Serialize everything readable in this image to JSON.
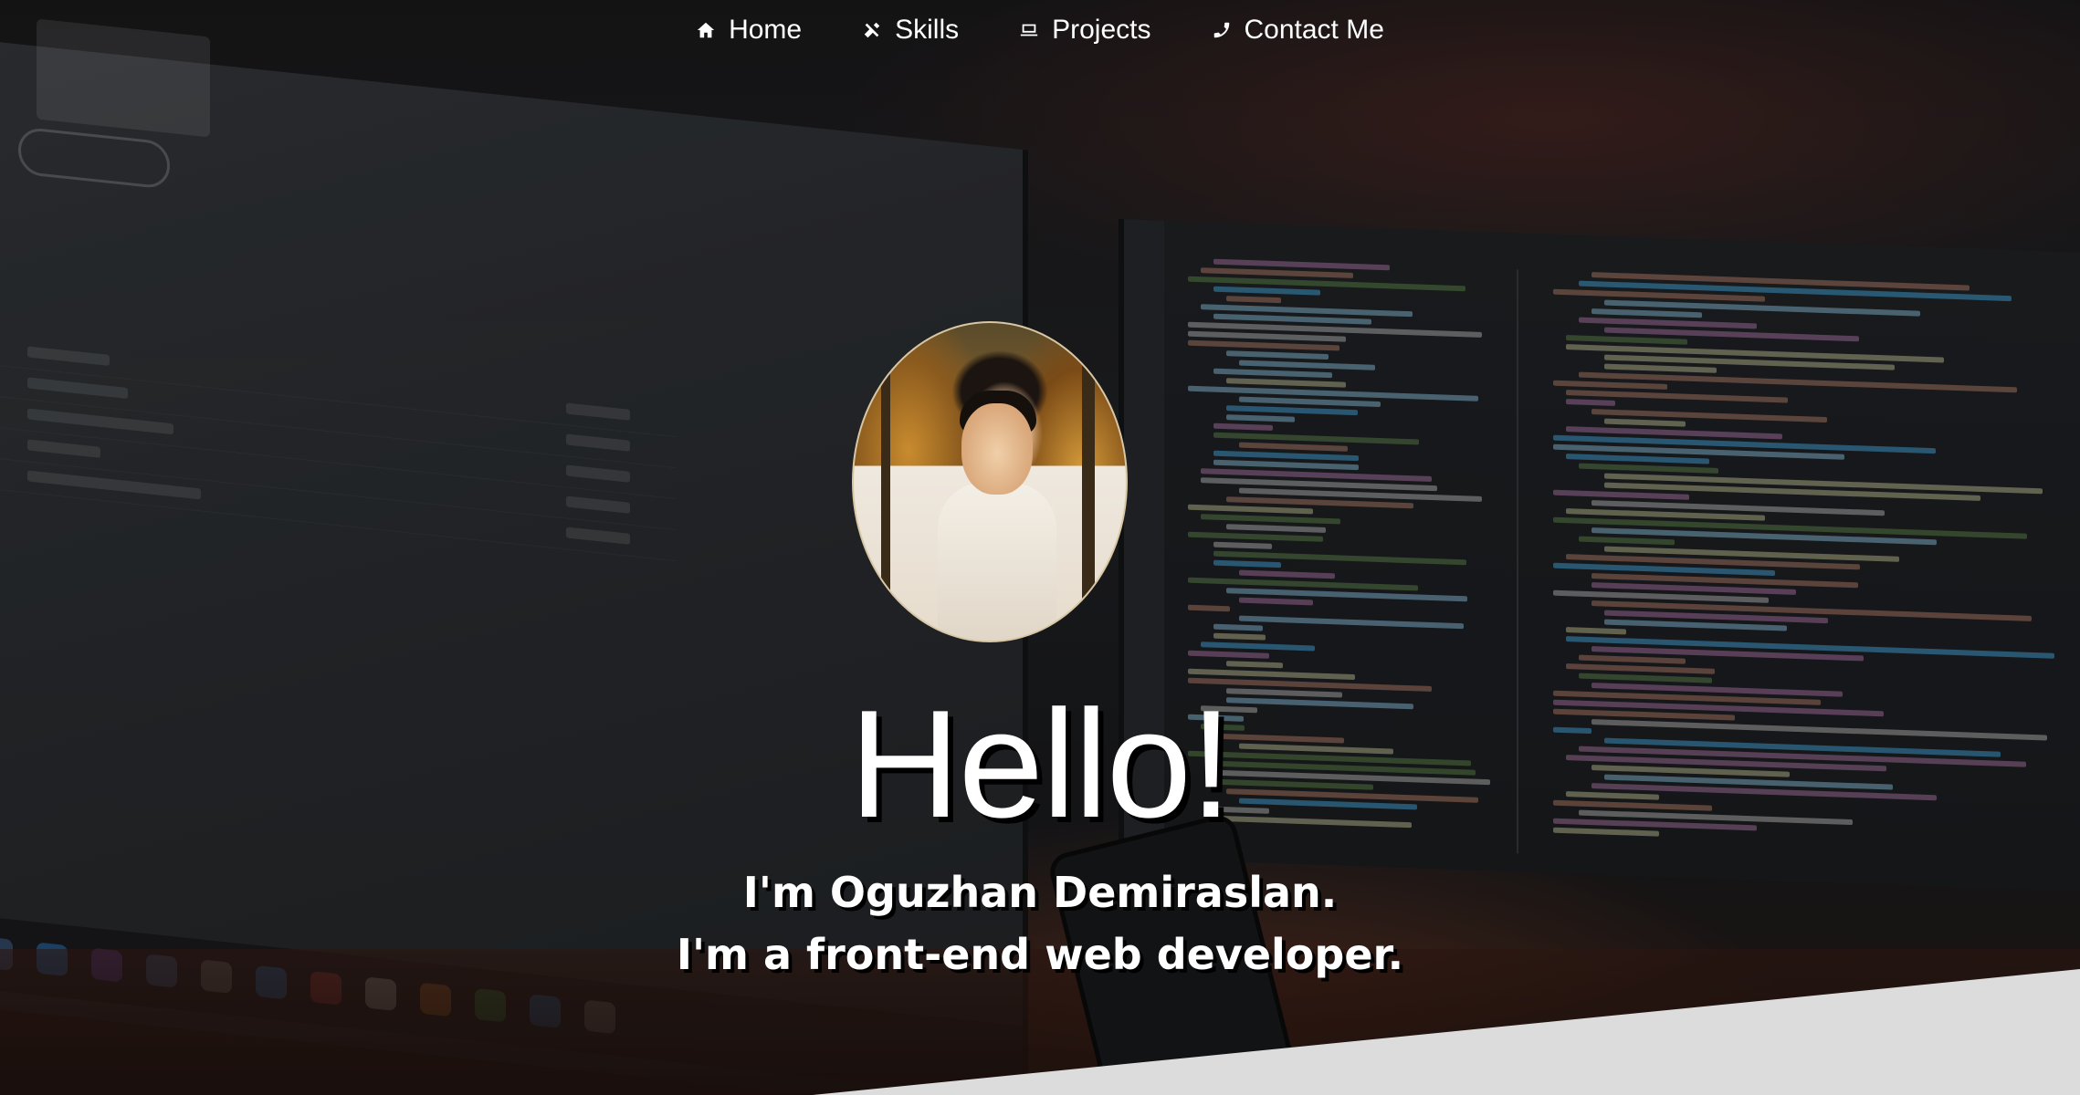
{
  "nav": {
    "items": [
      {
        "label": "Home",
        "icon": "home-icon"
      },
      {
        "label": "Skills",
        "icon": "tools-icon"
      },
      {
        "label": "Projects",
        "icon": "laptop-icon"
      },
      {
        "label": "Contact Me",
        "icon": "phone-icon"
      }
    ]
  },
  "hero": {
    "greeting": "Hello!",
    "intro_line1": "I'm Oguzhan Demiraslan.",
    "intro_line2": "I'm a front-end web developer.",
    "avatar_alt": "profile photo"
  },
  "colors": {
    "text": "#ffffff",
    "text_shadow": "#000000",
    "bottom_wedge": "#dcdcdc"
  }
}
